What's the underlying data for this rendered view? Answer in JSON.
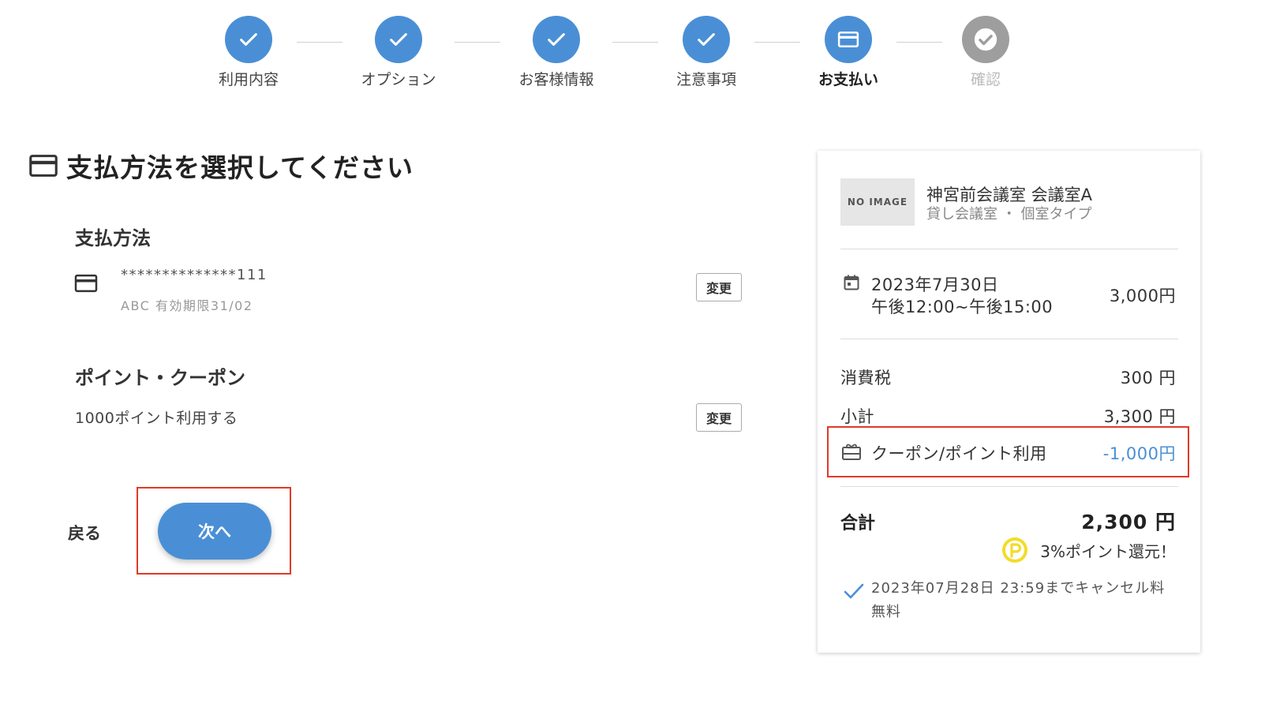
{
  "stepper": {
    "steps": [
      {
        "label": "利用内容",
        "state": "done"
      },
      {
        "label": "オプション",
        "state": "done"
      },
      {
        "label": "お客様情報",
        "state": "done"
      },
      {
        "label": "注意事項",
        "state": "done"
      },
      {
        "label": "お支払い",
        "state": "current"
      },
      {
        "label": "確認",
        "state": "todo"
      }
    ]
  },
  "main": {
    "title": "支払方法を選択してください",
    "payment": {
      "heading": "支払方法",
      "card_number": "**************111",
      "card_sub": "ABC 有効期限31/02",
      "change_label": "変更"
    },
    "points": {
      "heading": "ポイント・クーポン",
      "text": "1000ポイント利用する",
      "change_label": "変更"
    },
    "back_label": "戻る",
    "next_label": "次へ"
  },
  "summary": {
    "no_image": "NO IMAGE",
    "venue_name": "神宮前会議室 会議室A",
    "venue_type": "貸し会議室 ・ 個室タイプ",
    "date": "2023年7月30日",
    "time": "午後12:00~午後15:00",
    "price": "3,000円",
    "tax_label": "消費税",
    "tax_value": "300 円",
    "subtotal_label": "小計",
    "subtotal_value": "3,300 円",
    "coupon_label": "クーポン/ポイント利用",
    "coupon_value": "-1,000円",
    "total_label": "合計",
    "total_value": "2,300 円",
    "reward_text": "3%ポイント還元！",
    "cancel_text": "2023年07月28日 23:59までキャンセル料無料"
  },
  "colors": {
    "accent": "#4a8fd6",
    "highlight": "#e03a26",
    "todo": "#9e9e9e",
    "point_badge": "#f2dc2a"
  },
  "icons": [
    "check-icon",
    "credit-card-icon",
    "calendar-icon",
    "gift-icon",
    "point-icon"
  ]
}
